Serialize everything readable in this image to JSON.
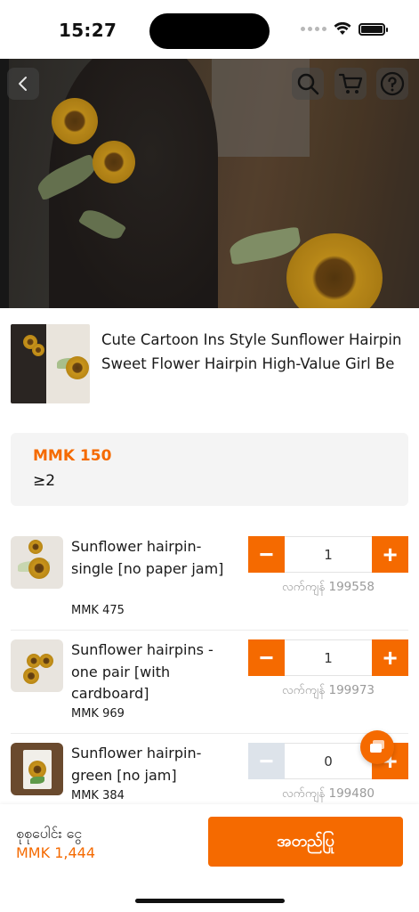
{
  "status_bar": {
    "time": "15:27"
  },
  "hero": {
    "back_icon": "chevron-left-icon",
    "search_icon": "search-icon",
    "cart_icon": "cart-icon",
    "help_icon": "help-icon"
  },
  "product": {
    "title": "Cute Cartoon Ins Style Sunflower Hairpin Sweet Flower Hairpin High-Value Girl Be"
  },
  "price_box": {
    "price": "MMK 150",
    "min_qty": "≥2"
  },
  "variants": [
    {
      "name": "Sunflower hairpin-single [no paper jam]",
      "price": "MMK 475",
      "qty": "1",
      "stock": "လက်ကျန် 199558",
      "minus_state": "active"
    },
    {
      "name": "Sunflower hairpins - one pair [with cardboard]",
      "price": "MMK 969",
      "qty": "1",
      "stock": "လက်ကျန် 199973",
      "minus_state": "active"
    },
    {
      "name": "Sunflower hairpin-green [no jam]",
      "price": "MMK 384",
      "qty": "0",
      "stock": "လက်ကျန် 199480",
      "minus_state": "disabled"
    }
  ],
  "stepper_labels": {
    "minus": "−",
    "plus": "+"
  },
  "bottom_bar": {
    "total_label": "စုစုပေါင်း ငွေ",
    "total_value": "MMK 1,444",
    "buy_label": "အတည်ပြု"
  },
  "colors": {
    "accent": "#f56a00",
    "price_box_bg": "#f4f4f4",
    "disabled_stepper": "#dde3ea",
    "muted_text": "#9a9a9a"
  }
}
